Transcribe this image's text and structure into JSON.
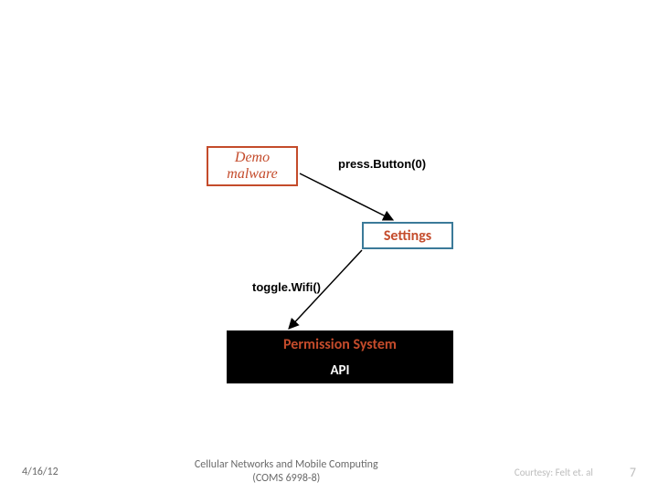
{
  "nodes": {
    "demo_malware": "Demo malware",
    "settings": "Settings",
    "permission_system": "Permission System",
    "api": "API"
  },
  "edges": {
    "press_button": "press.Button(0)",
    "toggle_wifi": "toggle.Wifi()"
  },
  "footer": {
    "date": "4/16/12",
    "center_line1": "Cellular Networks and Mobile Computing",
    "center_line2": "(COMS 6998-8)",
    "courtesy": "Courtesy: Felt et. al",
    "page": "7"
  },
  "colors": {
    "accent": "#c44b2b",
    "settings_border": "#3b7a99"
  }
}
